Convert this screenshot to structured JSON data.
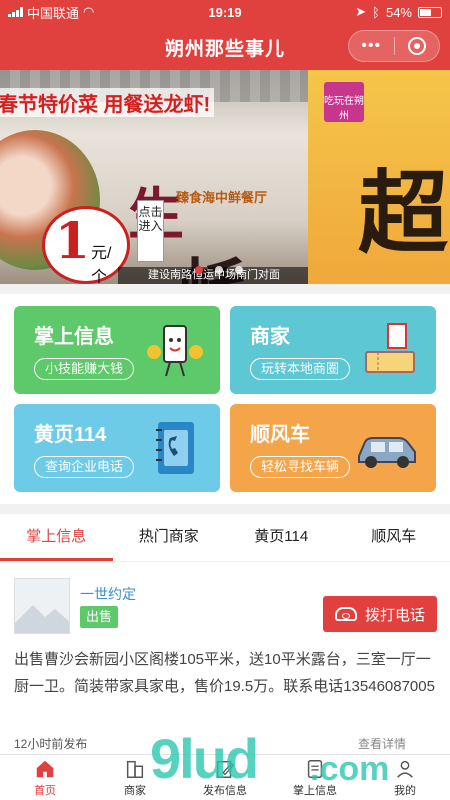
{
  "status_bar": {
    "carrier": "中国联通",
    "time": "19:19",
    "battery": "54%",
    "battery_level": 0.54
  },
  "header": {
    "title": "朔州那些事儿",
    "more_label": "•••"
  },
  "banner": {
    "slide1": {
      "promo_text": "春节特价菜 用餐送龙虾!",
      "price": "1",
      "price_unit": "元/个",
      "restaurant": "臻食海中鲜餐厅",
      "headline_1": "生",
      "headline_2": "蚝",
      "enter_label": "点击进入",
      "address": "建设南路恒运中场南门对面"
    },
    "slide2": {
      "logo_text": "吃玩在朔州",
      "headline": "超"
    }
  },
  "grid": [
    {
      "title": "掌上信息",
      "subtitle": "小技能赚大钱",
      "color": "#5dc96a"
    },
    {
      "title": "商家",
      "subtitle": "玩转本地商圈",
      "color": "#5ec7d4"
    },
    {
      "title": "黄页114",
      "subtitle": "查询企业电话",
      "color": "#6ecbe8"
    },
    {
      "title": "顺风车",
      "subtitle": "轻松寻找车辆",
      "color": "#f4a54a"
    }
  ],
  "tabs": [
    "掌上信息",
    "热门商家",
    "黄页114",
    "顺风车"
  ],
  "post": {
    "poster": "一世约定",
    "badge": "出售",
    "call_label": "拨打电话",
    "content": "出售曹沙会新园小区阁楼105平米，送10平米露台，三室一厅一厨一卫。简装带家具家电，售价19.5万。联系电话13546087005",
    "time": "12小时前发布",
    "views": "查看详情"
  },
  "tabbar": [
    {
      "label": "首页",
      "icon": "home-icon"
    },
    {
      "label": "商家",
      "icon": "store-icon"
    },
    {
      "label": "发布信息",
      "icon": "edit-icon"
    },
    {
      "label": "掌上信息",
      "icon": "info-icon"
    },
    {
      "label": "我的",
      "icon": "user-icon"
    }
  ],
  "watermark": {
    "main": "9lud",
    "suffix": ".com"
  },
  "colors": {
    "brand": "#e0413f",
    "link": "#3a8fd6",
    "green": "#5dc96a"
  }
}
